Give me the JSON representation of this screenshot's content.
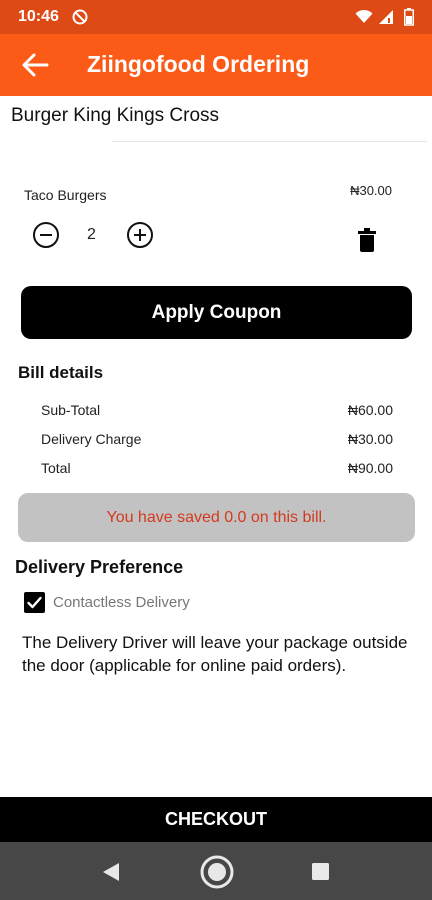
{
  "status_bar": {
    "time": "10:46"
  },
  "app_bar": {
    "title": "Ziingofood Ordering"
  },
  "restaurant": {
    "name": "Burger King Kings Cross"
  },
  "cart_item": {
    "name": "Taco Burgers",
    "price": "₦30.00",
    "quantity": "2"
  },
  "coupon": {
    "label": "Apply Coupon"
  },
  "bill": {
    "title": "Bill details",
    "rows": [
      {
        "label": "Sub-Total",
        "value": "₦60.00"
      },
      {
        "label": "Delivery Charge",
        "value": "₦30.00"
      },
      {
        "label": "Total",
        "value": "₦90.00"
      }
    ],
    "savings_text": "You have saved 0.0 on this bill."
  },
  "delivery_preference": {
    "title": "Delivery Preference",
    "option_label": "Contactless Delivery",
    "option_checked": true,
    "note": "The Delivery Driver will leave your package outside the door (applicable for online paid orders)."
  },
  "checkout": {
    "label": "CHECKOUT"
  },
  "icons": {
    "back": "arrow-left-icon",
    "minus": "minus-circle-icon",
    "plus": "plus-circle-icon",
    "delete": "trash-icon",
    "checkbox": "checkmark-icon"
  },
  "colors": {
    "status_bar": "#de4a16",
    "app_bar": "#fb5a17",
    "savings_text": "#d33a1f",
    "savings_bg": "#c2c2c2",
    "button_bg": "#000000",
    "nav_bar": "#474747"
  }
}
